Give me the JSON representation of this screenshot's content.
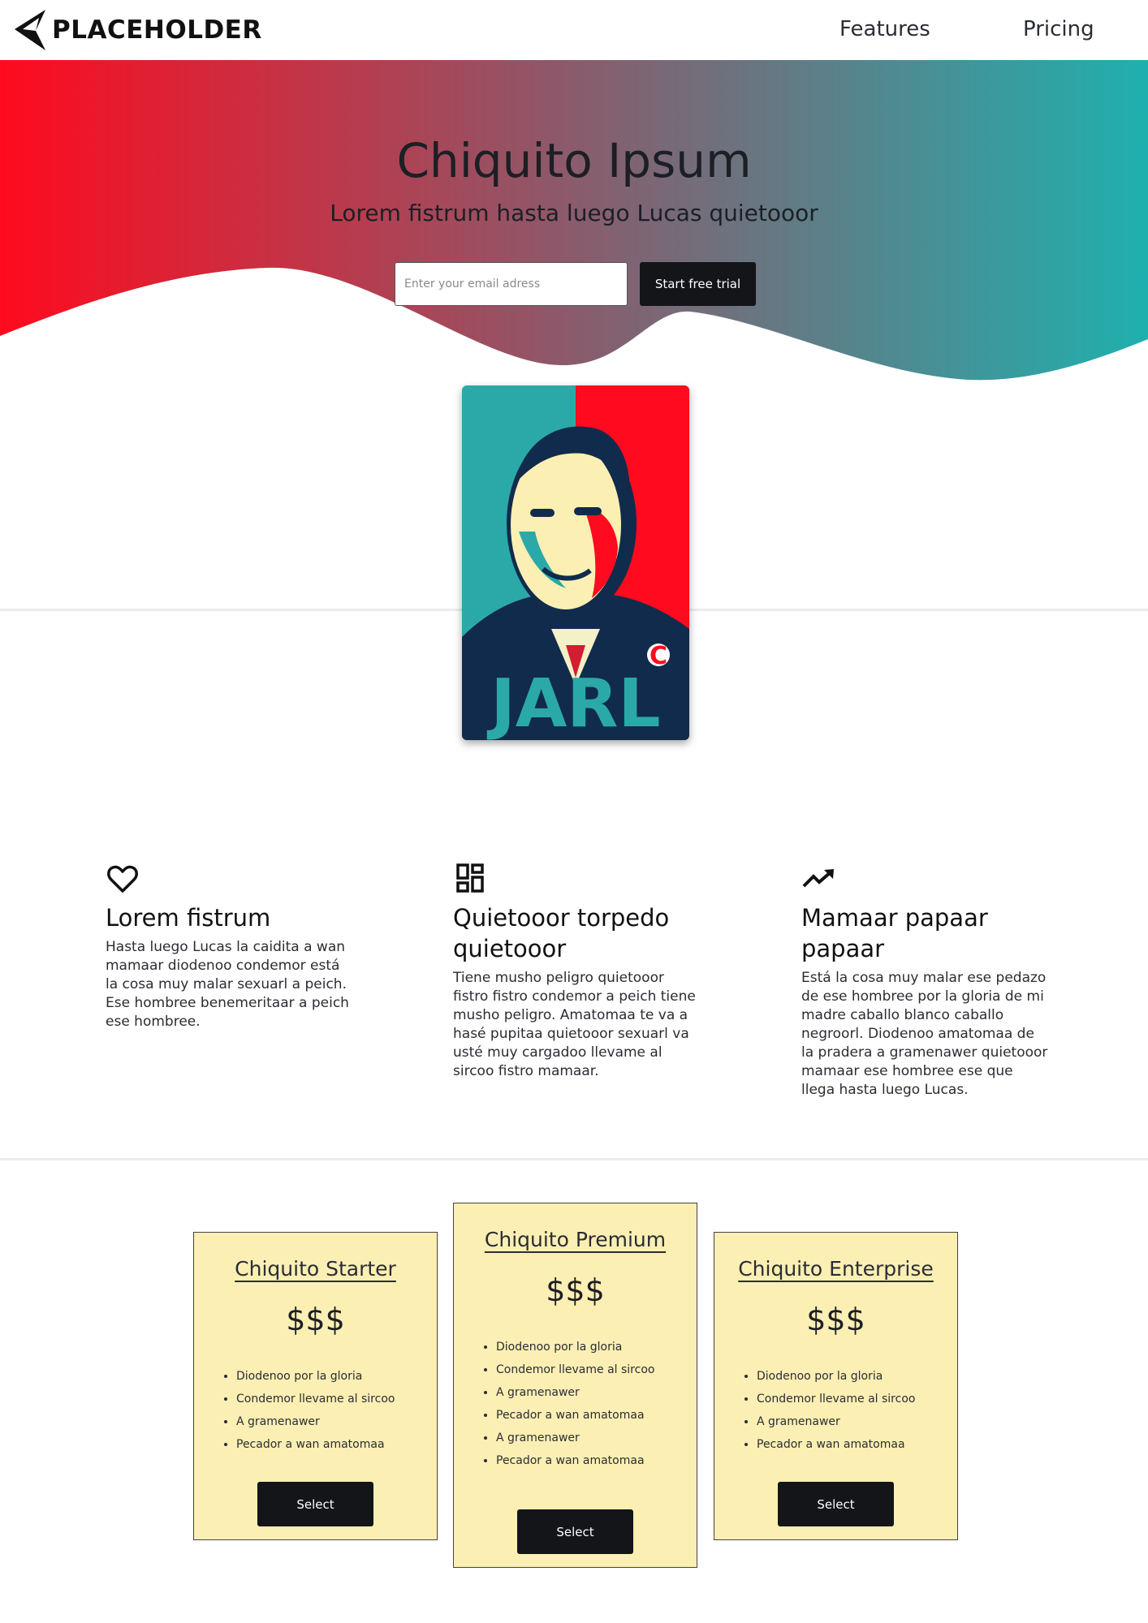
{
  "header": {
    "brand": "PLACEHOLDER",
    "nav": {
      "features": "Features",
      "pricing": "Pricing"
    }
  },
  "hero": {
    "title": "Chiquito Ipsum",
    "subtitle": "Lorem fistrum hasta luego Lucas quietooor",
    "email_placeholder": "Enter your email adress",
    "cta_label": "Start free trial"
  },
  "poster": {
    "caption": "JARL",
    "badge": "C"
  },
  "features": [
    {
      "icon": "heart-icon",
      "title": "Lorem fistrum",
      "text": "Hasta luego Lucas la caidita a wan mamaar diodenoo condemor está la cosa muy malar sexuarl a peich. Ese hombree benemeritaar a peich ese hombree."
    },
    {
      "icon": "dashboard-icon",
      "title": "Quietooor torpedo quietooor",
      "text": "Tiene musho peligro quietooor fistro fistro condemor a peich tiene musho peligro. Amatomaa te va a hasé pupitaa quietooor sexuarl va usté muy cargadoo llevame al sircoo fistro mamaar."
    },
    {
      "icon": "trending-up-icon",
      "title": "Mamaar papaar papaar",
      "text": "Está la cosa muy malar ese pedazo de ese hombree por la gloria de mi madre caballo blanco caballo negroorl. Diodenoo amatomaa de la pradera a gramenawer quietooor mamaar ese hombree ese que llega hasta luego Lucas."
    }
  ],
  "plans": [
    {
      "name": "Chiquito Starter",
      "price": "$$$",
      "items": [
        "Diodenoo por la gloria",
        "Condemor llevame al sircoo",
        "A gramenawer",
        "Pecador a wan amatomaa"
      ],
      "button": "Select"
    },
    {
      "name": "Chiquito Premium",
      "price": "$$$",
      "items": [
        "Diodenoo por la gloria",
        "Condemor llevame al sircoo",
        "A gramenawer",
        "Pecador a wan amatomaa",
        "A gramenawer",
        "Pecador a wan amatomaa"
      ],
      "button": "Select"
    },
    {
      "name": "Chiquito Enterprise",
      "price": "$$$",
      "items": [
        "Diodenoo por la gloria",
        "Condemor llevame al sircoo",
        "A gramenawer",
        "Pecador a wan amatomaa"
      ],
      "button": "Select"
    }
  ],
  "colors": {
    "gradient_start": "#ff0a1e",
    "gradient_end": "#1fb0ae",
    "button_bg": "#131519",
    "plan_card_bg": "#fcefb4"
  }
}
